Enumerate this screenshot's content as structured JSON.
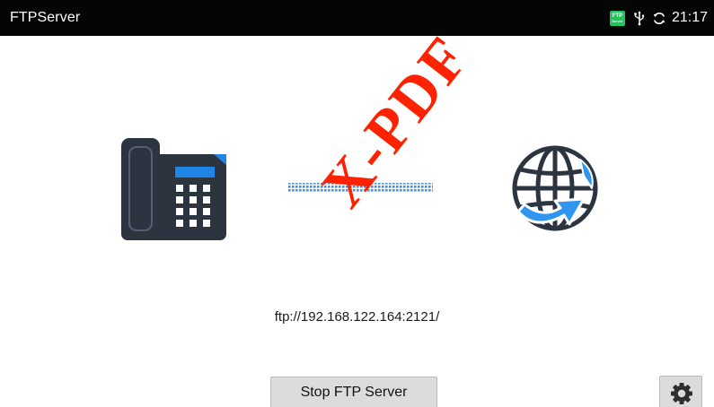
{
  "status_bar": {
    "app_title": "FTPServer",
    "ftp_badge_label": "FTP",
    "ftp_badge_sublabel": "Server",
    "time": "21:17",
    "icons": [
      "ftp-server-icon",
      "usb-icon",
      "sync-icon"
    ]
  },
  "main": {
    "server_address": "ftp://192.168.122.164:2121/",
    "stop_button_label": "Stop FTP Server",
    "watermark_text": "X-PDF",
    "illustration_icons": [
      "desk-phone-icon",
      "connection-dots-icon",
      "globe-icon"
    ]
  },
  "colors": {
    "status_bar_bg": "#050505",
    "ftp_badge": "#23c35f",
    "phone_body": "#2c3440",
    "phone_screen": "#1f86e8",
    "connection_dots": "#3a94f2",
    "globe": "#2c3440",
    "globe_arrow": "#2f95ee",
    "watermark": "#ff2200",
    "button_bg": "#dcdcdc"
  }
}
